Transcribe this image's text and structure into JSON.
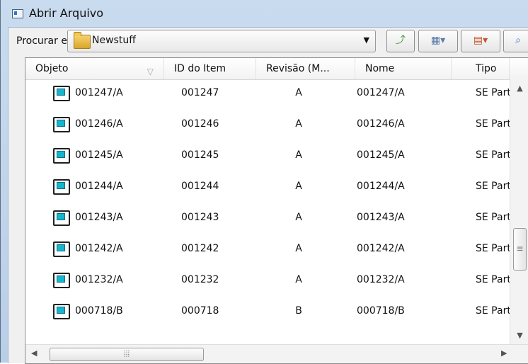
{
  "window": {
    "title": "Abrir Arquivo"
  },
  "toolbar": {
    "look_in_label": "Procurar em:",
    "look_in_value": "Newstuff",
    "up_icon": "folder-up-icon",
    "view_icon": "view-menu-icon",
    "sort_icon": "sort-menu-icon",
    "search_icon": "search-icon"
  },
  "list": {
    "columns": [
      "Objeto",
      "ID do Item",
      "Revisão (M...",
      "Nome",
      "Tipo"
    ],
    "rows": [
      {
        "objeto": "001247/A",
        "id": "001247",
        "rev": "A",
        "nome": "001247/A",
        "tipo": "SE Part"
      },
      {
        "objeto": "001246/A",
        "id": "001246",
        "rev": "A",
        "nome": "001246/A",
        "tipo": "SE Part"
      },
      {
        "objeto": "001245/A",
        "id": "001245",
        "rev": "A",
        "nome": "001245/A",
        "tipo": "SE Part"
      },
      {
        "objeto": "001244/A",
        "id": "001244",
        "rev": "A",
        "nome": "001244/A",
        "tipo": "SE Part"
      },
      {
        "objeto": "001243/A",
        "id": "001243",
        "rev": "A",
        "nome": "001243/A",
        "tipo": "SE Part"
      },
      {
        "objeto": "001242/A",
        "id": "001242",
        "rev": "A",
        "nome": "001242/A",
        "tipo": "SE Part"
      },
      {
        "objeto": "001232/A",
        "id": "001232",
        "rev": "A",
        "nome": "001232/A",
        "tipo": "SE Part"
      },
      {
        "objeto": "000718/B",
        "id": "000718",
        "rev": "B",
        "nome": "000718/B",
        "tipo": "SE Part"
      }
    ]
  },
  "colors": {
    "accent": "#12b7cf",
    "frame": "#c9dbee"
  }
}
